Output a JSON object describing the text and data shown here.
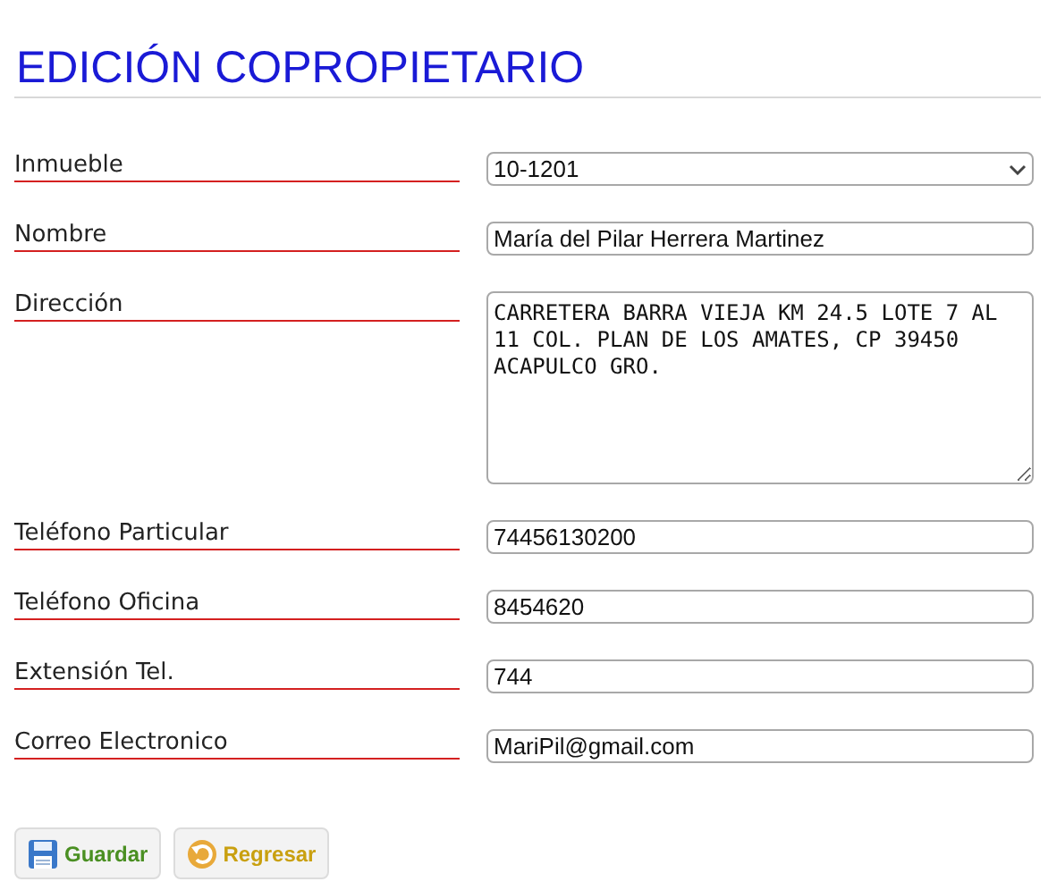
{
  "title": "EDICIÓN COPROPIETARIO",
  "fields": [
    {
      "label": "Inmueble",
      "kind": "select",
      "value": "10-1201"
    },
    {
      "label": "Nombre",
      "kind": "text",
      "value": "María del Pilar Herrera Martinez"
    },
    {
      "label": "Dirección",
      "kind": "textarea",
      "value": "CARRETERA BARRA VIEJA KM 24.5 LOTE 7 AL 11 COL. PLAN DE LOS AMATES, CP 39450 ACAPULCO GRO."
    },
    {
      "label": "Teléfono Particular",
      "kind": "text",
      "value": "74456130200"
    },
    {
      "label": "Teléfono Oficina",
      "kind": "text",
      "value": "8454620"
    },
    {
      "label": "Extensión Tel.",
      "kind": "text",
      "value": "744"
    },
    {
      "label": "Correo Electronico",
      "kind": "text",
      "value": "MariPil@gmail.com"
    }
  ],
  "buttons": [
    {
      "label": "Guardar",
      "kind": "save"
    },
    {
      "label": "Regresar",
      "kind": "back"
    }
  ]
}
